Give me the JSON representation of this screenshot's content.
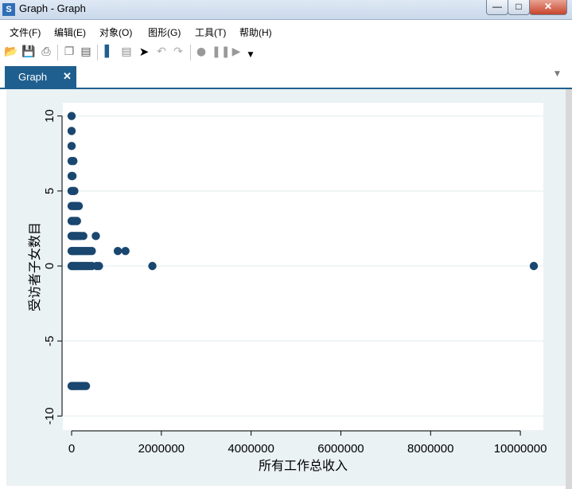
{
  "window": {
    "title": "Graph - Graph",
    "app_icon": "stata-icon",
    "controls": {
      "minimize": "—",
      "maximize": "□",
      "close": "✕"
    }
  },
  "menu": {
    "items": [
      {
        "label": "文件(F)"
      },
      {
        "label": "编辑(E)"
      },
      {
        "label": "对象(O)"
      },
      {
        "label": "图形(G)"
      },
      {
        "label": "工具(T)"
      },
      {
        "label": "帮助(H)"
      }
    ]
  },
  "toolbar": {
    "icons": [
      "open-icon",
      "save-icon",
      "print-icon",
      "copy-icon",
      "rename-icon",
      "graph-editor-icon",
      "data-editor-icon",
      "pointer-icon",
      "undo-icon",
      "redo-icon",
      "record-icon",
      "pause-icon",
      "play-icon",
      "dropdown-icon"
    ]
  },
  "tab": {
    "label": "Graph",
    "close": "✕"
  },
  "colors": {
    "plot_region": "#eaf2f3",
    "plot_bg": "#ffffff",
    "marker": "#1a476f",
    "tab": "#1f5f8f"
  },
  "chart_data": {
    "type": "scatter",
    "title": "",
    "xlabel": "所有工作总收入",
    "ylabel": "受访者子女数目",
    "xlim": [
      0,
      10300000
    ],
    "ylim": [
      -10.3,
      10.3
    ],
    "xticks": [
      0,
      2000000,
      4000000,
      6000000,
      8000000,
      10000000
    ],
    "xtick_labels": [
      "0",
      "2000000",
      "4000000",
      "6000000",
      "8000000",
      "10000000"
    ],
    "yticks": [
      10,
      5,
      0,
      -5,
      -10
    ],
    "ytick_labels": [
      "10",
      "5",
      "0",
      "-5",
      "-10"
    ],
    "grid": true,
    "legend": "none",
    "points": [
      {
        "x": 0,
        "y": 10
      },
      {
        "x": 0,
        "y": 9
      },
      {
        "x": 0,
        "y": 8
      },
      {
        "x": 0,
        "y": 7
      },
      {
        "x": 0,
        "y": 6
      },
      {
        "x": 20000,
        "y": 6
      },
      {
        "x": 40000,
        "y": 7
      },
      {
        "x": 0,
        "y": 5
      },
      {
        "x": 30000,
        "y": 5
      },
      {
        "x": 60000,
        "y": 5
      },
      {
        "x": 0,
        "y": 4
      },
      {
        "x": 30000,
        "y": 4
      },
      {
        "x": 60000,
        "y": 4
      },
      {
        "x": 90000,
        "y": 4
      },
      {
        "x": 120000,
        "y": 4
      },
      {
        "x": 160000,
        "y": 4
      },
      {
        "x": 0,
        "y": 3
      },
      {
        "x": 30000,
        "y": 3
      },
      {
        "x": 60000,
        "y": 3
      },
      {
        "x": 90000,
        "y": 3
      },
      {
        "x": 120000,
        "y": 3
      },
      {
        "x": 0,
        "y": 2
      },
      {
        "x": 30000,
        "y": 2
      },
      {
        "x": 60000,
        "y": 2
      },
      {
        "x": 90000,
        "y": 2
      },
      {
        "x": 120000,
        "y": 2
      },
      {
        "x": 160000,
        "y": 2
      },
      {
        "x": 200000,
        "y": 2
      },
      {
        "x": 260000,
        "y": 2
      },
      {
        "x": 540000,
        "y": 2
      },
      {
        "x": 0,
        "y": 1
      },
      {
        "x": 30000,
        "y": 1
      },
      {
        "x": 60000,
        "y": 1
      },
      {
        "x": 90000,
        "y": 1
      },
      {
        "x": 120000,
        "y": 1
      },
      {
        "x": 160000,
        "y": 1
      },
      {
        "x": 200000,
        "y": 1
      },
      {
        "x": 240000,
        "y": 1
      },
      {
        "x": 280000,
        "y": 1
      },
      {
        "x": 320000,
        "y": 1
      },
      {
        "x": 360000,
        "y": 1
      },
      {
        "x": 400000,
        "y": 1
      },
      {
        "x": 450000,
        "y": 1
      },
      {
        "x": 1030000,
        "y": 1
      },
      {
        "x": 1200000,
        "y": 1
      },
      {
        "x": 0,
        "y": 0
      },
      {
        "x": 30000,
        "y": 0
      },
      {
        "x": 60000,
        "y": 0
      },
      {
        "x": 90000,
        "y": 0
      },
      {
        "x": 120000,
        "y": 0
      },
      {
        "x": 160000,
        "y": 0
      },
      {
        "x": 200000,
        "y": 0
      },
      {
        "x": 240000,
        "y": 0
      },
      {
        "x": 280000,
        "y": 0
      },
      {
        "x": 320000,
        "y": 0
      },
      {
        "x": 360000,
        "y": 0
      },
      {
        "x": 400000,
        "y": 0
      },
      {
        "x": 450000,
        "y": 0
      },
      {
        "x": 560000,
        "y": 0
      },
      {
        "x": 610000,
        "y": 0
      },
      {
        "x": 1800000,
        "y": 0
      },
      {
        "x": 10300000,
        "y": 0
      },
      {
        "x": 0,
        "y": -8
      },
      {
        "x": 30000,
        "y": -8
      },
      {
        "x": 60000,
        "y": -8
      },
      {
        "x": 90000,
        "y": -8
      },
      {
        "x": 120000,
        "y": -8
      },
      {
        "x": 160000,
        "y": -8
      },
      {
        "x": 200000,
        "y": -8
      },
      {
        "x": 240000,
        "y": -8
      },
      {
        "x": 280000,
        "y": -8
      },
      {
        "x": 320000,
        "y": -8
      }
    ]
  }
}
